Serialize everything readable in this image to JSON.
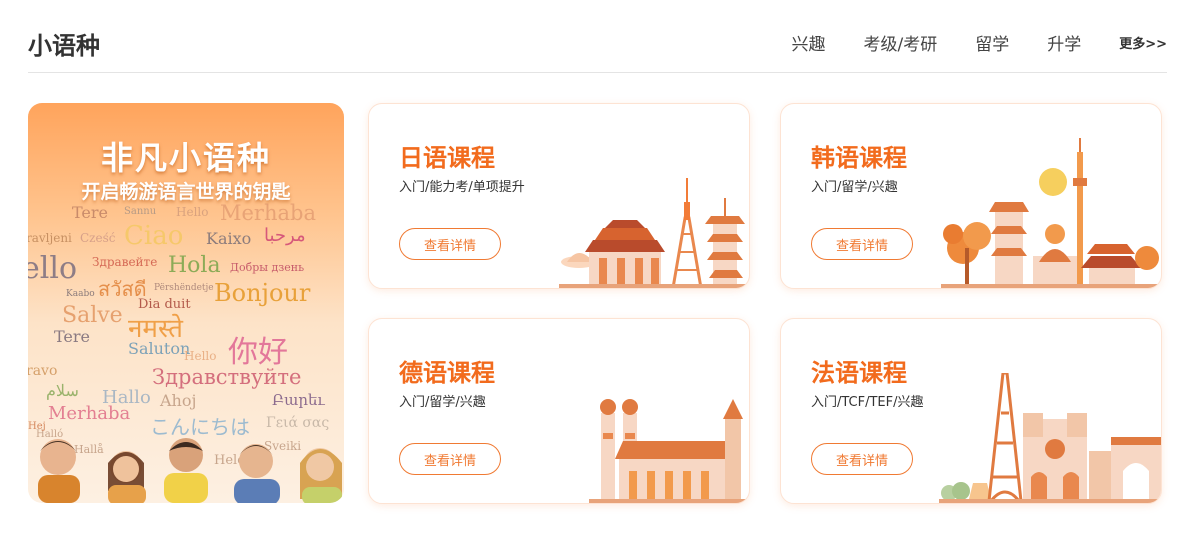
{
  "section": {
    "title": "小语种",
    "nav": [
      "兴趣",
      "考级/考研",
      "留学",
      "升学"
    ],
    "more": "更多>>"
  },
  "banner": {
    "title": "非凡小语种",
    "subtitle": "开启畅游语言世界的钥匙",
    "words": [
      "Tere",
      "Sannu",
      "Hello",
      "Merhaba",
      "Ciao",
      "Kaixo",
      "مرحبا",
      "ravljeni",
      "Cześć",
      "ello",
      "Здравейте",
      "Hola",
      "Добры дзень",
      "สวัสดี",
      "Përshëndetje",
      "Bonjour",
      "Kaabo",
      "Dia duit",
      "Salve",
      "नमस्ते",
      "Tere",
      "你好",
      "Saluton",
      "Hello",
      "Здравствуйте",
      "Hallo",
      "Ahoj",
      "Բարեւ",
      "سلام",
      "ravo",
      "Merhaba",
      "こんにちは",
      "Γειά σας",
      "Hallå",
      "Helo",
      "Sveiki",
      "Halló",
      "Hej"
    ],
    "colors": {
      "accent": "#f26b1d",
      "gradient_top": "#ffa45c",
      "gradient_bottom": "#fdf0e2"
    }
  },
  "cards": [
    {
      "title": "日语课程",
      "desc": "入门/能力考/单项提升",
      "button": "查看详情",
      "art": "japan-landmarks"
    },
    {
      "title": "韩语课程",
      "desc": "入门/留学/兴趣",
      "button": "查看详情",
      "art": "korea-landmarks"
    },
    {
      "title": "德语课程",
      "desc": "入门/留学/兴趣",
      "button": "查看详情",
      "art": "germany-landmarks"
    },
    {
      "title": "法语课程",
      "desc": "入门/TCF/TEF/兴趣",
      "button": "查看详情",
      "art": "france-landmarks"
    }
  ]
}
